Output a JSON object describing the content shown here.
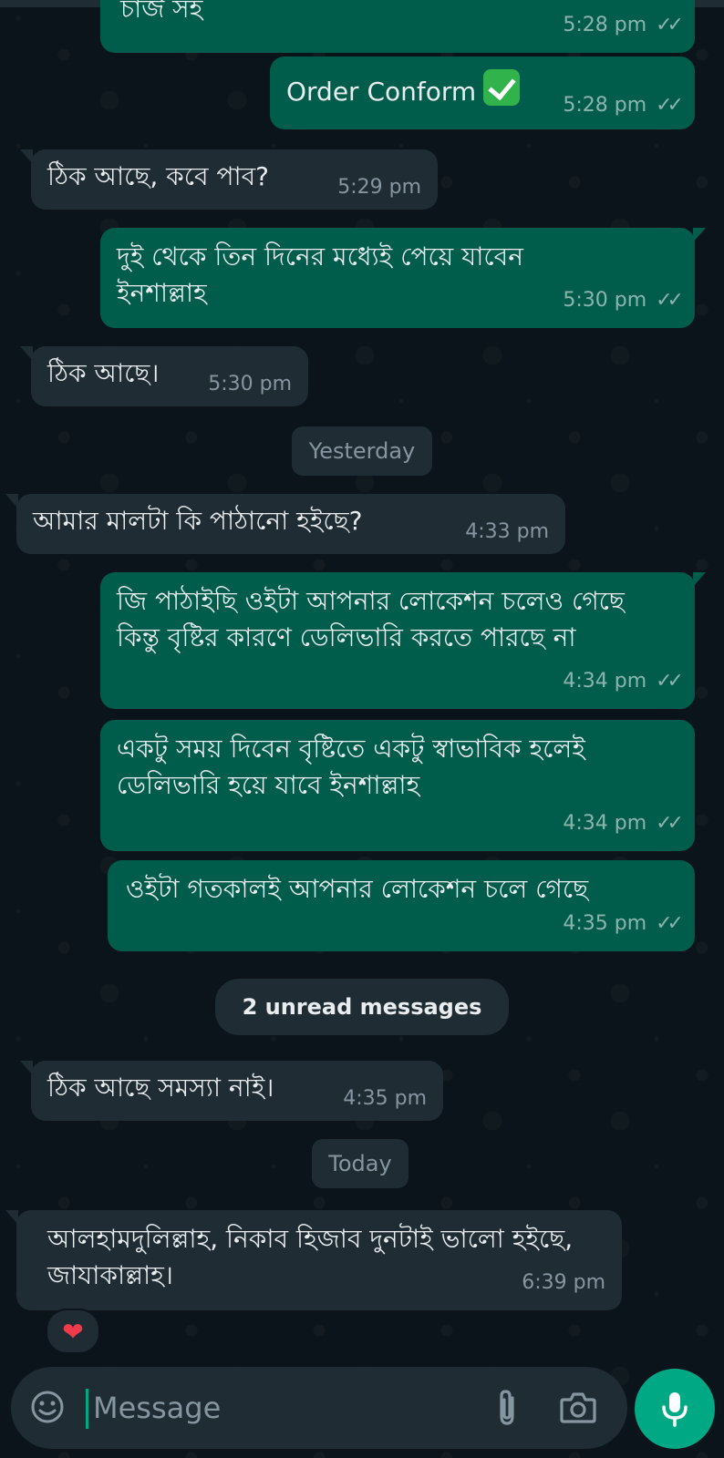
{
  "messages": [
    {
      "dir": "out",
      "text": "চার্জ সহ",
      "time": "5:28 pm",
      "ticks": "✓✓"
    },
    {
      "dir": "out",
      "text": "Order Conform",
      "time": "5:28 pm",
      "ticks": "✓✓",
      "emoji": "check-mark-button"
    },
    {
      "dir": "in",
      "text": "ঠিক আছে, কবে পাব?",
      "time": "5:29 pm"
    },
    {
      "dir": "out",
      "text": "দুই থেকে তিন দিনের মধ্যেই পেয়ে যাবেন ইনশাল্লাহ",
      "time": "5:30 pm",
      "ticks": "✓✓"
    },
    {
      "dir": "in",
      "text": "ঠিক আছে।",
      "time": "5:30 pm"
    },
    {
      "dir": "in",
      "text": "আমার মালটা কি পাঠানো হইছে?",
      "time": "4:33 pm"
    },
    {
      "dir": "out",
      "text": "জি পাঠাইছি ওইটা আপনার লোকেশন চলেও গেছে কিন্তু বৃষ্টির কারণে ডেলিভারি করতে পারছে না",
      "time": "4:34 pm",
      "ticks": "✓✓"
    },
    {
      "dir": "out",
      "text": "একটু সময় দিবেন বৃষ্টিতে একটু স্বাভাবিক হলেই ডেলিভারি হয়ে যাবে ইনশাল্লাহ",
      "time": "4:34 pm",
      "ticks": "✓✓"
    },
    {
      "dir": "out",
      "text": "ওইটা গতকালই আপনার লোকেশন চলে গেছে",
      "time": "4:35 pm",
      "ticks": "✓✓"
    },
    {
      "dir": "in",
      "text": "ঠিক আছে সমস্যা নাই।",
      "time": "4:35 pm"
    },
    {
      "dir": "in",
      "text": "আলহামদুলিল্লাহ, নিকাব হিজাব দুনটাই ভালো হইছে, জাযাকাল্লাহ।",
      "time": "6:39 pm",
      "reaction": "heart"
    }
  ],
  "separators": {
    "yesterday": "Yesterday",
    "unread": "2 unread messages",
    "today": "Today"
  },
  "reaction": {
    "icon": "heart-icon",
    "glyph": "❤"
  },
  "composer": {
    "placeholder": "Message",
    "emoji_icon": "smiley-icon",
    "attach_icon": "paperclip-icon",
    "camera_icon": "camera-icon",
    "mic_icon": "microphone-icon"
  },
  "colors": {
    "background": "#0b141a",
    "incoming_bubble": "#1f2c34",
    "outgoing_bubble": "#005c4b",
    "accent": "#00a884",
    "meta_text": "#8696a0",
    "primary_text": "#e9edef"
  }
}
